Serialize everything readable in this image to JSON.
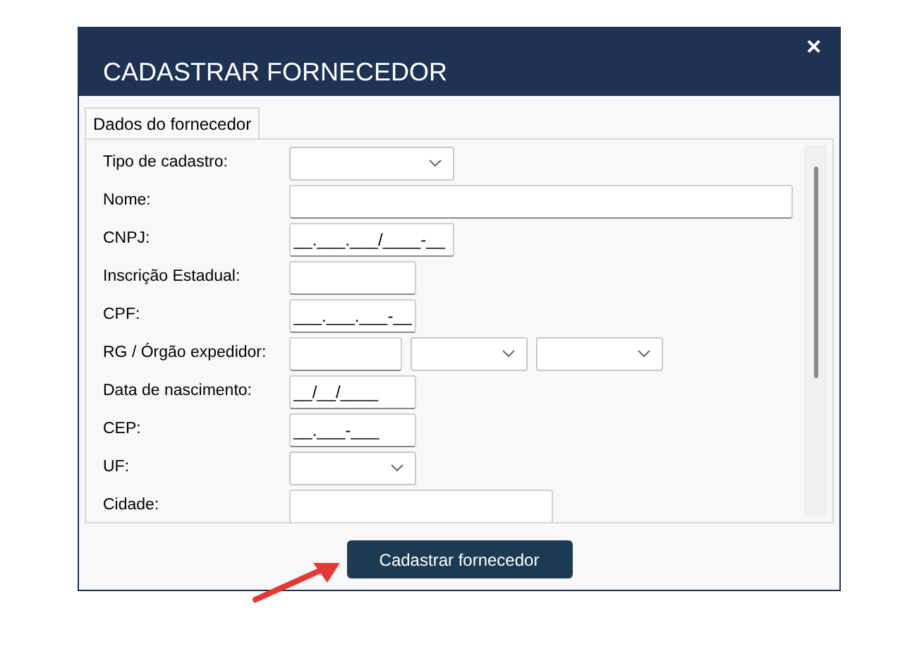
{
  "window": {
    "title": "CADASTRAR FORNECEDOR",
    "close": "✕"
  },
  "tabs": [
    {
      "label": "Dados do fornecedor",
      "selected": true
    }
  ],
  "form": [
    {
      "label": "Tipo de cadastro:",
      "controls": [
        {
          "kind": "select"
        }
      ]
    },
    {
      "label": "Nome:",
      "controls": [
        {
          "kind": "text"
        }
      ]
    },
    {
      "label": "CNPJ:",
      "controls": [
        {
          "kind": "text",
          "value": "__.___.___/____-__"
        }
      ]
    },
    {
      "label": "Inscrição Estadual:",
      "controls": [
        {
          "kind": "text"
        }
      ]
    },
    {
      "label": "CPF:",
      "controls": [
        {
          "kind": "text",
          "value": "___.___.___-__"
        }
      ]
    },
    {
      "label": "RG / Órgão expedidor:",
      "controls": [
        {
          "kind": "text"
        },
        {
          "kind": "select"
        },
        {
          "kind": "select"
        }
      ]
    },
    {
      "label": "Data de nascimento:",
      "controls": [
        {
          "kind": "text",
          "value": "__/__/____"
        }
      ]
    },
    {
      "label": "CEP:",
      "controls": [
        {
          "kind": "text",
          "value": "__.___-___"
        }
      ]
    },
    {
      "label": "UF:",
      "controls": [
        {
          "kind": "select"
        }
      ]
    },
    {
      "label": "Cidade:",
      "controls": [
        {
          "kind": "text"
        }
      ]
    }
  ],
  "submit": "Cadastrar fornecedor"
}
